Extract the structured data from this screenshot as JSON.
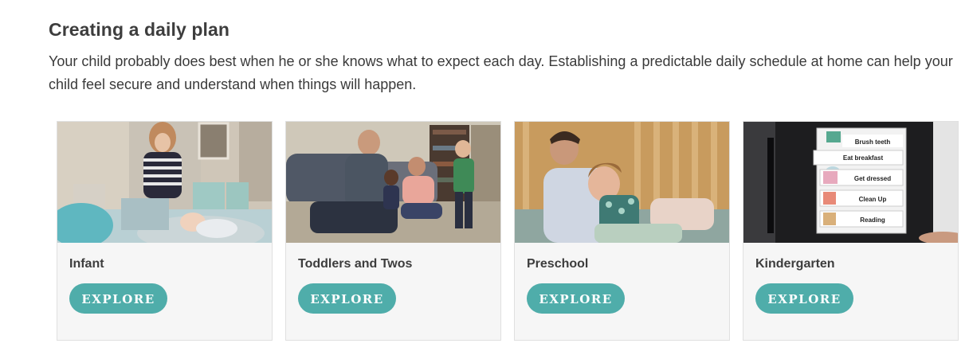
{
  "section": {
    "title": "Creating a daily plan",
    "intro": "Your child probably does best when he or she knows what to expect each day. Establishing a predictable daily schedule at home can help your child feel secure and understand when things will happen."
  },
  "cards": [
    {
      "label": "Infant",
      "button": "EXPLORE"
    },
    {
      "label": "Toddlers and Twos",
      "button": "EXPLORE"
    },
    {
      "label": "Preschool",
      "button": "EXPLORE"
    },
    {
      "label": "Kindergarten",
      "button": "EXPLORE"
    }
  ],
  "chart_strips": [
    "Brush teeth",
    "Eat breakfast",
    "Get dressed",
    "Clean Up",
    "Reading"
  ],
  "colors": {
    "accent": "#4fadaa",
    "card_bg": "#f6f6f6",
    "text": "#3a3a3a"
  }
}
